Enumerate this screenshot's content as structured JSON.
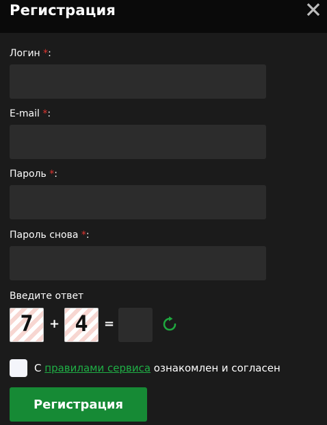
{
  "header": {
    "title": "Регистрация"
  },
  "form": {
    "required_mark": "*",
    "login": {
      "label": "Логин",
      "suffix": ":",
      "value": ""
    },
    "email": {
      "label": "E-mail",
      "suffix": ":",
      "value": ""
    },
    "password": {
      "label": "Пароль",
      "suffix": ":",
      "value": ""
    },
    "password_repeat": {
      "label": "Пароль снова",
      "suffix": ":",
      "value": ""
    }
  },
  "captcha": {
    "prompt": "Введите ответ",
    "operand1": "7",
    "operator": "+",
    "operand2": "4",
    "equals": "=",
    "answer": ""
  },
  "agreement": {
    "prefix": "С",
    "link_text": "правилами сервиса",
    "suffix": "ознакомлен и согласен",
    "checked": false
  },
  "submit_label": "Регистрация",
  "colors": {
    "header_bg": "#0a0a0a",
    "panel_bg": "#1b1b1b",
    "input_bg": "#2c2c2c",
    "required": "#e0342f",
    "accent_green": "#168a35",
    "link_green": "#1fb046"
  },
  "icons": {
    "close": "close-icon",
    "refresh": "refresh-icon"
  }
}
